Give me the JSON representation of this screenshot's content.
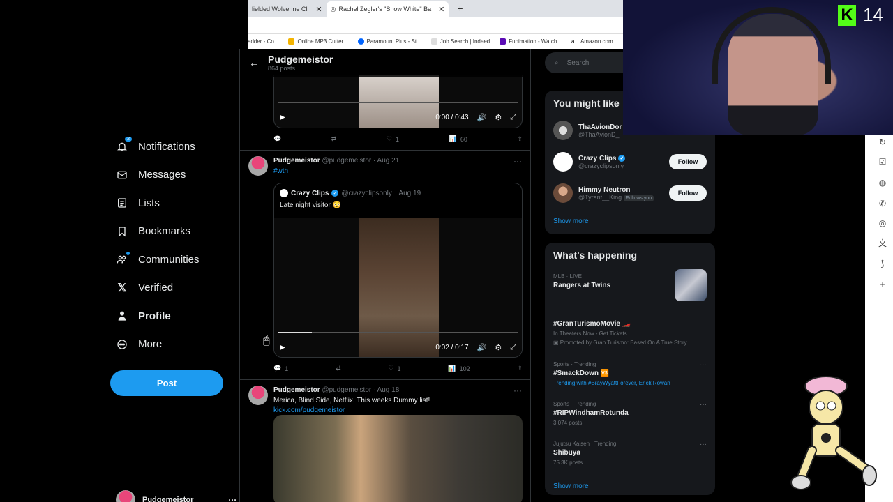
{
  "browser": {
    "tabs": [
      {
        "label": "lielded Wolverine Cli",
        "active": false
      },
      {
        "label": "Rachel Zegler's \"Snow White\" Ba",
        "active": true
      }
    ],
    "bookmarks": [
      "adder - Co...",
      "Online MP3 Cutter...",
      "Paramount Plus - St...",
      "Job Search | Indeed",
      "Funimation - Watch...",
      "Amazon.com"
    ]
  },
  "nav": {
    "items": [
      {
        "label": "Notifications",
        "icon": "bell-icon",
        "badge": "2"
      },
      {
        "label": "Messages",
        "icon": "envelope-icon"
      },
      {
        "label": "Lists",
        "icon": "list-icon"
      },
      {
        "label": "Bookmarks",
        "icon": "bookmark-icon"
      },
      {
        "label": "Communities",
        "icon": "communities-icon"
      },
      {
        "label": "Verified",
        "icon": "x-logo-icon"
      },
      {
        "label": "Profile",
        "icon": "person-icon"
      },
      {
        "label": "More",
        "icon": "more-circle-icon"
      }
    ],
    "post_label": "Post",
    "account_name": "Pudgemeistor"
  },
  "profile_header": {
    "name": "Pudgemeistor",
    "posts": "864 posts"
  },
  "video_top": {
    "time": "0:00 / 0:43",
    "progress": 0
  },
  "tweet_top_actions": {
    "replies": "",
    "likes": "1",
    "views": "60"
  },
  "tweet1": {
    "name": "Pudgemeistor",
    "handle": "@pudgemeistor",
    "date": "· Aug 21",
    "text": "#wth",
    "quote": {
      "name": "Crazy Clips",
      "handle": "@crazyclipsonly",
      "date": "· Aug 19",
      "text": "Late night visitor 😳",
      "video_time": "0:02 / 0:17",
      "progress": 0.14
    },
    "replies": "1",
    "likes": "1",
    "views": "102"
  },
  "tweet2": {
    "name": "Pudgemeistor",
    "handle": "@pudgemeistor",
    "date": "· Aug 18",
    "text": "Merica, Blind Side, Netflix. This weeks Dummy list!",
    "link": "kick.com/pudgemeistor"
  },
  "right": {
    "search_placeholder": "Search",
    "wtf_title": "You might like",
    "wtf": [
      {
        "name": "ThaAvionDor",
        "handle": "@ThaAvionD_",
        "verified": false,
        "follows_you": false,
        "show_button": false
      },
      {
        "name": "Crazy Clips",
        "handle": "@crazyclipsonly",
        "verified": true,
        "follows_you": false,
        "show_button": true
      },
      {
        "name": "Himmy Neutron",
        "handle": "@Tyrant__King",
        "verified": false,
        "follows_you": true,
        "show_button": true
      }
    ],
    "follow_label": "Follow",
    "follows_you_label": "Follows you",
    "show_more": "Show more",
    "happening_title": "What's happening",
    "trends": [
      {
        "meta": "MLB · LIVE",
        "title": "Rangers at Twins",
        "sub": ""
      },
      {
        "meta": "",
        "title": "#GranTurismoMovie 🏎️",
        "sub": "In Theaters Now - Get Tickets",
        "sub2": "Promoted by Gran Turismo: Based On A True Story"
      },
      {
        "meta": "Sports · Trending",
        "title": "#SmackDown 🆚",
        "sub": "Trending with #BrayWyattForever, Erick Rowan"
      },
      {
        "meta": "Sports · Trending",
        "title": "#RIPWindhamRotunda",
        "sub": "3,074 posts"
      },
      {
        "meta": "Jujutsu Kaisen · Trending",
        "title": "Shibuya",
        "sub": "75.3K posts"
      }
    ]
  },
  "stream": {
    "kick_count": "14",
    "kick_letter": "K"
  }
}
